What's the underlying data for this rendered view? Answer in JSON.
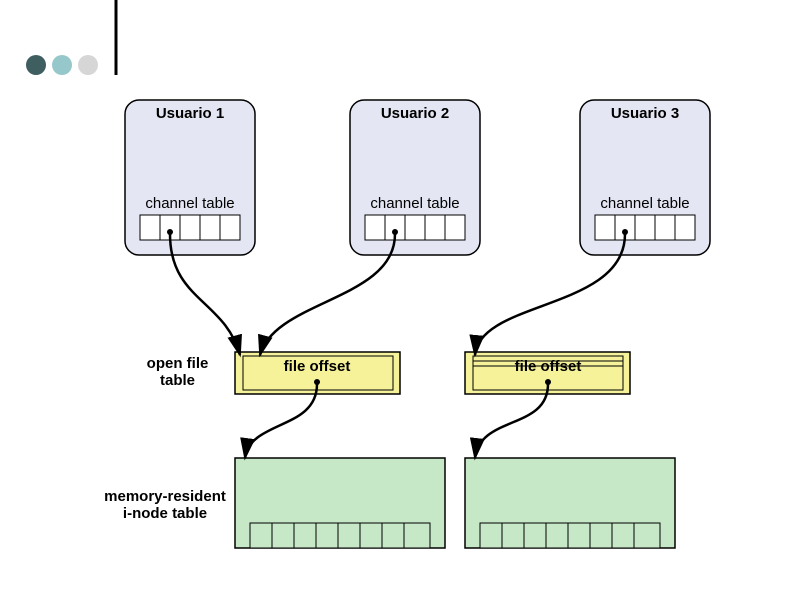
{
  "bullets": {
    "colors": [
      "#3f5e5f",
      "#96c8cb",
      "#d6d6d6"
    ]
  },
  "users": [
    {
      "title": "Usuario 1",
      "subtitle": "channel table"
    },
    {
      "title": "Usuario 2",
      "subtitle": "channel table"
    },
    {
      "title": "Usuario 3",
      "subtitle": "channel table"
    }
  ],
  "open_file_table_label": "open file\ntable",
  "file_offset": [
    "file offset",
    "file offset"
  ],
  "inode_label": "memory-resident\ni-node table"
}
